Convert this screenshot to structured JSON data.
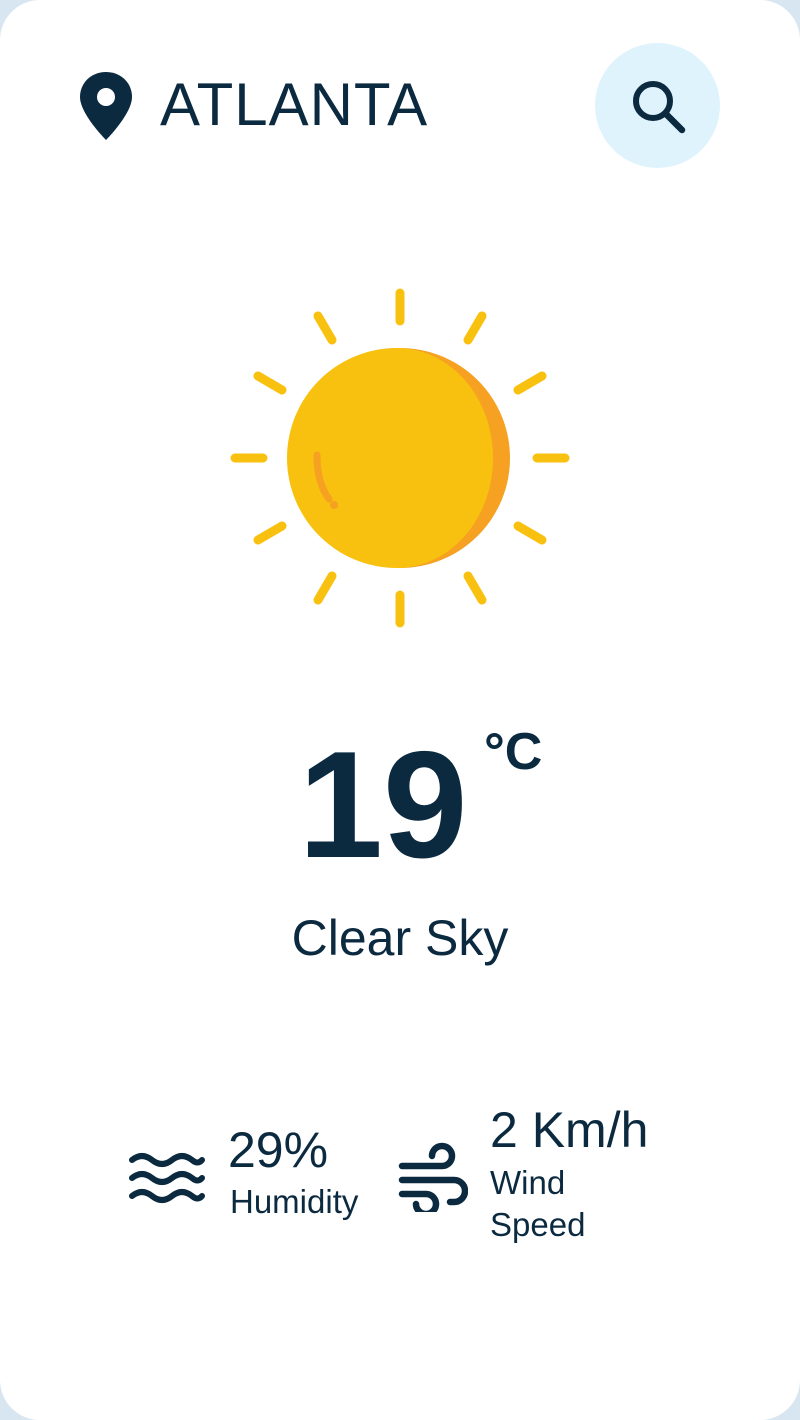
{
  "header": {
    "city": "ATLANTA",
    "location_icon": "map-pin-icon",
    "search_icon": "search-icon"
  },
  "weather": {
    "icon": "sun-icon",
    "temperature": "19",
    "unit": "°C",
    "condition": "Clear Sky"
  },
  "stats": {
    "humidity": {
      "icon": "humidity-waves-icon",
      "value": "29%",
      "label": "Humidity"
    },
    "wind": {
      "icon": "wind-icon",
      "value": "2 Km/h",
      "label": "Wind Speed"
    }
  },
  "colors": {
    "text": "#0b2a40",
    "search_button_bg": "#dff3fd",
    "sun_main": "#f9c10f",
    "sun_shade": "#f6a121",
    "card_bg": "#ffffff",
    "page_bg": "#d7e6f1"
  }
}
